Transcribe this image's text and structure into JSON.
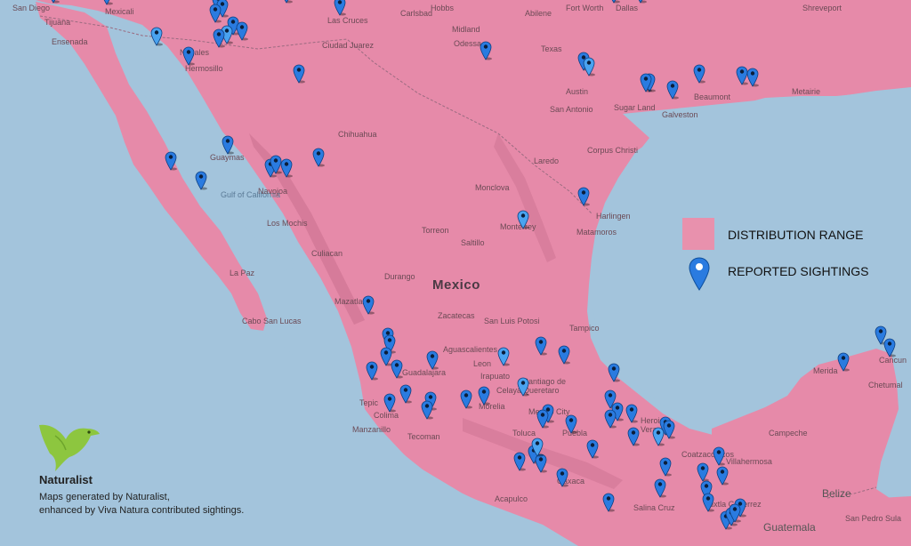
{
  "legend": {
    "range_label": "DISTRIBUTION RANGE",
    "sightings_label": "REPORTED SIGHTINGS",
    "range_color": "#e891ad",
    "pin_color": "#2a7be0"
  },
  "brand": {
    "name": "Naturalist",
    "credit_line_1": "Maps generated by Naturalist,",
    "credit_line_2": "enhanced by Viva Natura contributed sightings."
  },
  "places": [
    "San Diego",
    "Tijuana",
    "Ensenada",
    "Mexicali",
    "Las Cruces",
    "Carlsbad",
    "Hobbs",
    "Abilene",
    "Fort Worth",
    "Dallas",
    "Shreveport",
    "Ciudad Juarez",
    "Midland",
    "Odessa",
    "Texas",
    "Austin",
    "San Antonio",
    "Sugar Land",
    "Beaumont",
    "Galveston",
    "Metairie",
    "Nogales",
    "Hermosillo",
    "Chihuahua",
    "Guaymas",
    "Gulf of California",
    "Navojoa",
    "Los Mochis",
    "Culiacan",
    "La Paz",
    "Cabo San Lucas",
    "Mazatlan",
    "Durango",
    "Torreon",
    "Saltillo",
    "Monterrey",
    "Monclova",
    "Laredo",
    "Corpus Christi",
    "Harlingen",
    "Matamoros",
    "Mexico",
    "Zacatecas",
    "San Luis Potosi",
    "Tampico",
    "Aguascalientes",
    "Leon",
    "Guadalajara",
    "Irapuato",
    "Celaya",
    "Santiago de Queretaro",
    "Morelia",
    "Mexico City",
    "Toluca",
    "Puebla",
    "Heroica Veracruz",
    "Coatzacoalcos",
    "Oaxaca",
    "Villahermosa",
    "Campeche",
    "Merida",
    "Cancun",
    "Chetumal",
    "Manzanillo",
    "Tecoman",
    "Acapulco",
    "Salina Cruz",
    "Tuxtla Gutierrez",
    "Belize",
    "Guatemala",
    "San Pedro Sula",
    "Tepic",
    "Colima"
  ],
  "sightings_count": 93
}
